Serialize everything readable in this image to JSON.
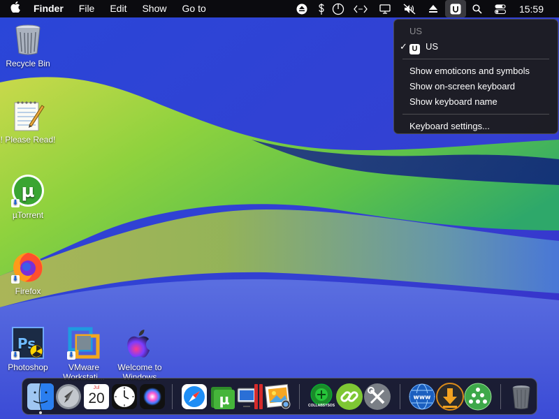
{
  "menubar": {
    "apple_icon": "apple-logo-icon",
    "app_name": "Finder",
    "menus": [
      "File",
      "Edit",
      "Show",
      "Go to"
    ],
    "status_icons": [
      "eject-icon",
      "dollar-icon",
      "power-icon",
      "code-icon",
      "display-icon",
      "mute-icon",
      "eject-triangle-icon",
      "keyboard-input-u-icon",
      "search-icon",
      "control-center-icon"
    ],
    "clock": "15:59"
  },
  "input_menu": {
    "header": "US",
    "selected_source": "US",
    "source_badge": "U",
    "items": [
      "Show emoticons and symbols",
      "Show on-screen keyboard",
      "Show keyboard name"
    ],
    "settings": "Keyboard settings..."
  },
  "desktop_icons": [
    {
      "label": "Recycle Bin",
      "icon": "recycle-bin-icon"
    },
    {
      "label": "! Please Read!",
      "icon": "notepad-icon"
    },
    {
      "label": "µTorrent",
      "icon": "utorrent-icon"
    },
    {
      "label": "Firefox",
      "icon": "firefox-icon"
    },
    {
      "label": "Photoshop",
      "icon": "photoshop-icon"
    },
    {
      "label": "VMware Workstati...",
      "icon": "vmware-icon"
    },
    {
      "label": "Welcome to Windows",
      "icon": "apple-welcome-icon"
    }
  ],
  "dock": {
    "calendar_month": "Jul",
    "calendar_day": "20",
    "collabs_label": "COLLABSYSOS",
    "items": [
      "finder-icon",
      "launchpad-icon",
      "calendar-icon",
      "clock-icon",
      "siri-icon",
      "safari-icon",
      "utorrent-icon",
      "parallels-icon",
      "preview-icon",
      "collabsysos-icon",
      "link-icon",
      "tools-icon",
      "www-icon",
      "download-icon",
      "network-icon",
      "trash-icon"
    ]
  },
  "colors": {
    "menubar_bg": "#0b0b0f",
    "wallpaper_blue": "#3148d8",
    "wallpaper_green": "#7fd13a"
  }
}
